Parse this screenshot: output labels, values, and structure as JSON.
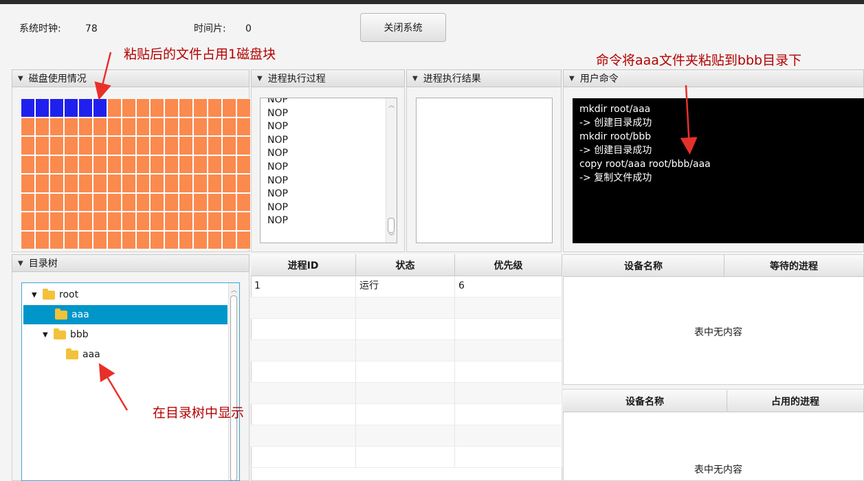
{
  "topbar": {
    "clock_label": "系统时钟:",
    "clock_value": "78",
    "timeslice_label": "时间片:",
    "timeslice_value": "0",
    "close_button": "关闭系统"
  },
  "panels": {
    "disk": "磁盘使用情况",
    "exec_process": "进程执行过程",
    "exec_result": "进程执行结果",
    "user_command": "用户命令",
    "dir_tree": "目录树"
  },
  "disk": {
    "rows": 8,
    "cols": 16,
    "used_blocks": 6,
    "used_color": "#2020ee",
    "free_color": "#fb8a4e"
  },
  "exec_process_items": [
    "NOP",
    "NOP",
    "NOP",
    "NOP",
    "NOP",
    "NOP",
    "NOP",
    "NOP",
    "NOP",
    "NOP"
  ],
  "console_lines": [
    "mkdir root/aaa",
    "-> 创建目录成功",
    "mkdir root/bbb",
    "-> 创建目录成功",
    "copy root/aaa root/bbb/aaa",
    "-> 复制文件成功"
  ],
  "tree": {
    "root": "root",
    "aaa": "aaa",
    "bbb": "bbb",
    "bbb_aaa": "aaa"
  },
  "process_table": {
    "headers": [
      "进程ID",
      "状态",
      "优先级"
    ],
    "rows": [
      [
        "1",
        "运行",
        "6"
      ]
    ]
  },
  "device_wait_table": {
    "headers": [
      "设备名称",
      "等待的进程"
    ],
    "empty": "表中无内容"
  },
  "device_use_table": {
    "headers": [
      "设备名称",
      "占用的进程"
    ],
    "empty": "表中无内容"
  },
  "annotations": {
    "disk_note": "粘贴后的文件占用1磁盘块",
    "command_note": "命令将aaa文件夹粘贴到bbb目录下",
    "tree_note": "在目录树中显示"
  },
  "colors": {
    "annotation": "#b30000",
    "selection": "#0096c9"
  }
}
